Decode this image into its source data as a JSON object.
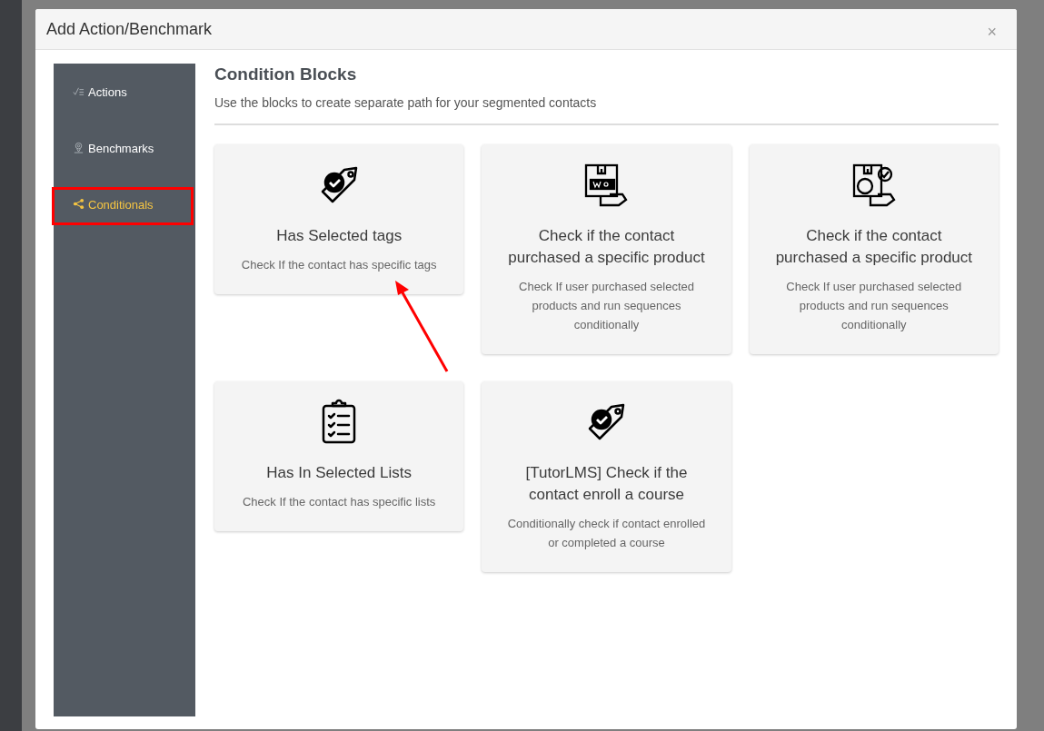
{
  "dialog": {
    "title": "Add Action/Benchmark",
    "close": "×"
  },
  "sidebar": {
    "items": [
      {
        "label": "Actions",
        "kind": "checklist",
        "selected": false,
        "highlighted": false
      },
      {
        "label": "Benchmarks",
        "kind": "pin",
        "selected": false,
        "highlighted": false
      },
      {
        "label": "Conditionals",
        "kind": "share",
        "selected": true,
        "highlighted": true
      }
    ]
  },
  "content": {
    "title": "Condition Blocks",
    "subtitle": "Use the blocks to create separate path for your segmented contacts",
    "arrow_shown": true,
    "blocks": [
      {
        "kind": "tag",
        "title": "Has Selected tags",
        "description": "Check If the contact has specific tags"
      },
      {
        "kind": "woo",
        "title": "Check if the contact purchased a specific product",
        "description": "Check If user purchased selected products and run sequences conditionally"
      },
      {
        "kind": "box-check",
        "title": "Check if the contact purchased a specific product",
        "description": "Check If user purchased selected products and run sequences conditionally"
      },
      {
        "kind": "clipboard",
        "title": "Has In Selected Lists",
        "description": "Check If the contact has specific lists"
      },
      {
        "kind": "tag",
        "title": "[TutorLMS] Check if the contact enroll a course",
        "description": "Conditionally check if contact enrolled or completed a course"
      }
    ]
  }
}
